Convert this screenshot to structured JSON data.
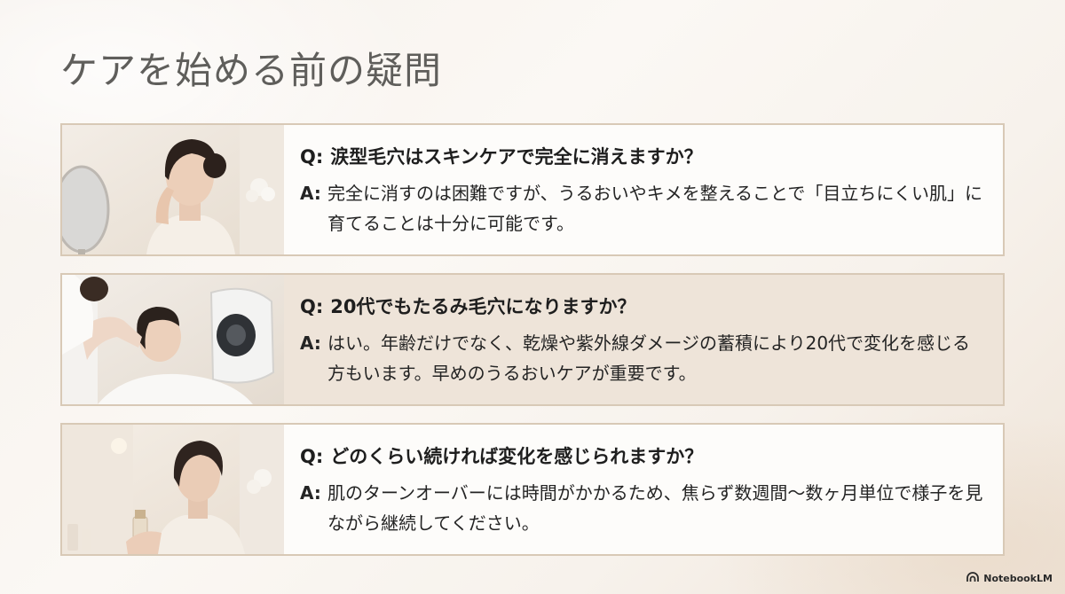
{
  "title": "ケアを始める前の疑問",
  "labels": {
    "q": "Q:",
    "a": "A:"
  },
  "faq": [
    {
      "question": "涙型毛穴はスキンケアで完全に消えますか？",
      "answer": "完全に消すのは困難ですが、うるおいやキメを整えることで「目立ちにくい肌」に育てることは十分に可能です。",
      "image_icon": "woman-touching-cheek-mirror-photo"
    },
    {
      "question": "20代でもたるみ毛穴になりますか？",
      "answer": "はい。年齢だけでなく、乾燥や紫外線ダメージの蓄積により20代で変化を感じる方もいます。早めのうるおいケアが重要です。",
      "image_icon": "facial-treatment-skin-analyzer-photo"
    },
    {
      "question": "どのくらい続ければ変化を感じられますか？",
      "answer": "肌のターンオーバーには時間がかかるため、焦らず数週間〜数ヶ月単位で様子を見ながら継続してください。",
      "image_icon": "woman-holding-skincare-bottle-photo"
    }
  ],
  "branding": {
    "name": "NotebookLM",
    "icon": "notebooklm-logo-icon"
  },
  "colors": {
    "card_border": "#d8c9b6",
    "card_shaded": "#eee4d9",
    "title_text": "#5f5e5b"
  }
}
